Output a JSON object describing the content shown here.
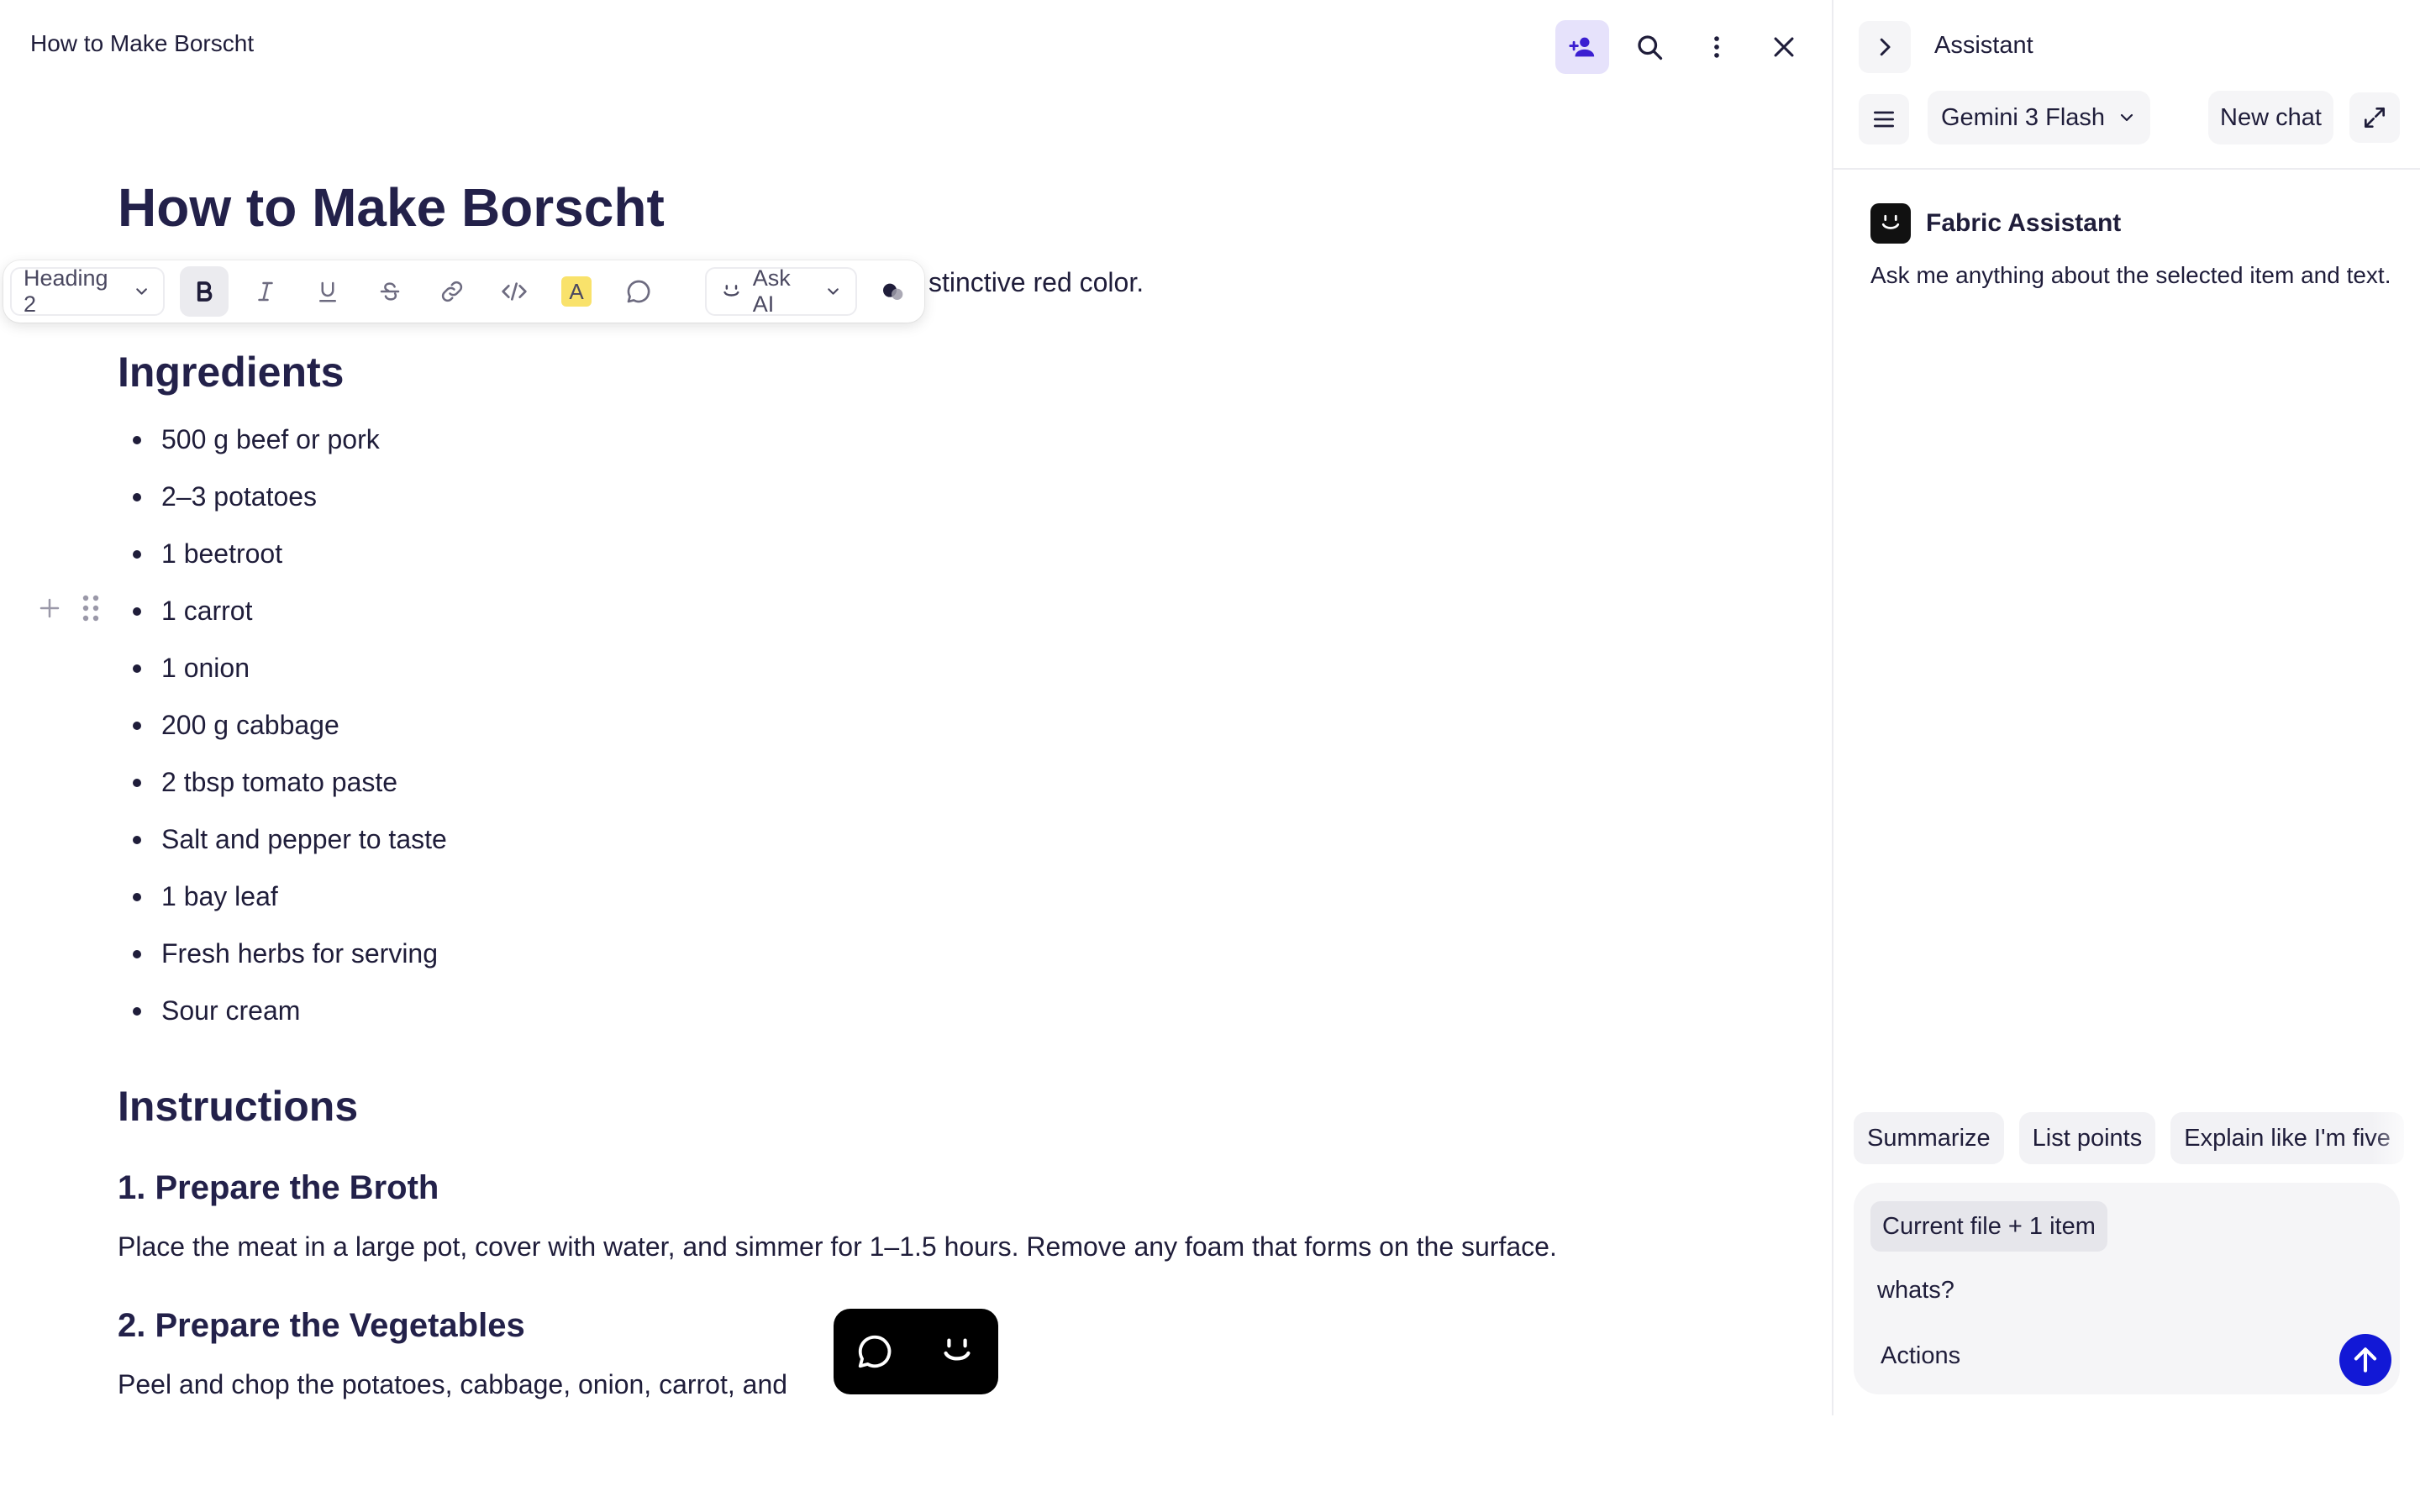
{
  "document": {
    "window_title": "How to Make Borscht",
    "title": "How to Make Borscht",
    "intro_visible": "stinctive red color.",
    "ingredients_heading": "Ingredients",
    "ingredients": [
      "500 g beef or pork",
      "2–3 potatoes",
      "1 beetroot",
      "1 carrot",
      "1 onion",
      "200 g cabbage",
      "2 tbsp tomato paste",
      "Salt and pepper to taste",
      "1 bay leaf",
      "Fresh herbs for serving",
      "Sour cream"
    ],
    "instructions_heading": "Instructions",
    "steps": [
      {
        "heading": "1. Prepare the Broth",
        "text": "Place the meat in a large pot, cover with water, and simmer for 1–1.5 hours. Remove any foam that forms on the surface."
      },
      {
        "heading": "2. Prepare the Vegetables",
        "text": "Peel and chop the potatoes, cabbage, onion, carrot, and"
      }
    ]
  },
  "toolbar": {
    "block_type": "Heading 2",
    "ask_ai_label": "Ask AI",
    "highlight_letter": "A"
  },
  "assistant": {
    "panel_title": "Assistant",
    "model": "Gemini 3 Flash",
    "new_chat_label": "New chat",
    "sender": "Fabric Assistant",
    "message": "Ask me anything about the selected item and text.",
    "suggestions": [
      "Summarize",
      "List points",
      "Explain like I'm five"
    ],
    "context_chip": "Current file + 1 item",
    "input_text": "whats?",
    "actions_label": "Actions"
  },
  "colors": {
    "accent": "#1218d6",
    "active_button_bg": "#e6e2fb",
    "highlight_yellow": "#f9e26b",
    "heading_text": "#23214a"
  }
}
